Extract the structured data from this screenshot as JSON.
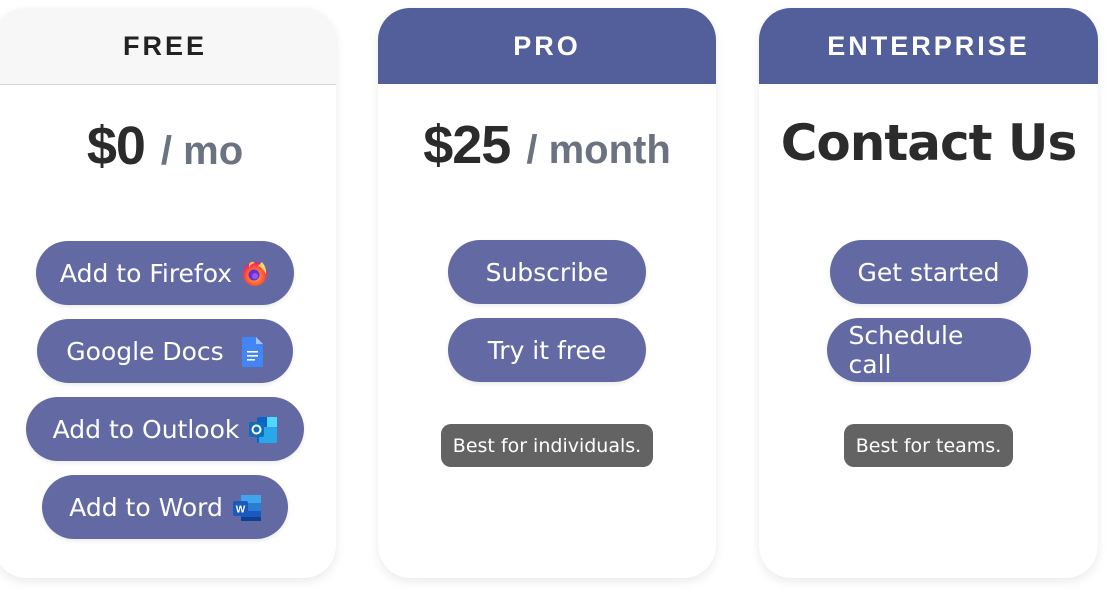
{
  "plans": [
    {
      "name": "FREE",
      "price": "$0",
      "period": "/ mo",
      "buttons": [
        {
          "label": "Add to Firefox",
          "icon": "firefox-icon"
        },
        {
          "label": "Google Docs",
          "icon": "google-docs-icon"
        },
        {
          "label": "Add to Outlook",
          "icon": "outlook-icon"
        },
        {
          "label": "Add to Word",
          "icon": "word-icon"
        }
      ]
    },
    {
      "name": "PRO",
      "price": "$25",
      "period": "/ month",
      "buttons": [
        {
          "label": "Subscribe"
        },
        {
          "label": "Try it free"
        }
      ],
      "badge": "Best for individuals."
    },
    {
      "name": "ENTERPRISE",
      "price": "Contact Us",
      "buttons": [
        {
          "label": "Get started"
        },
        {
          "label": "Schedule call"
        }
      ],
      "badge": "Best for teams."
    }
  ],
  "colors": {
    "header_accent": "#535f9a",
    "button": "#636aa3",
    "badge": "#636363",
    "free_header": "#f7f7f7"
  }
}
